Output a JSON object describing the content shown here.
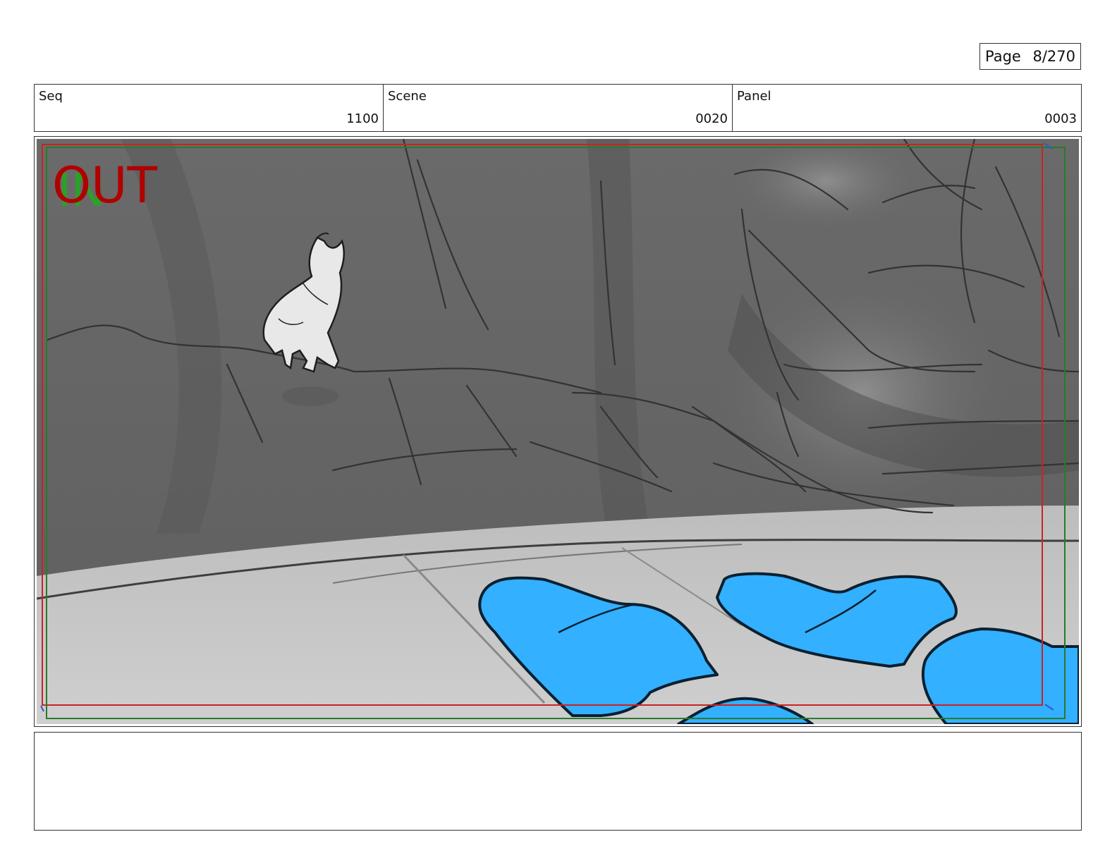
{
  "page": {
    "label": "Page",
    "number": "8/270"
  },
  "meta": {
    "seq": {
      "label": "Seq",
      "value": "1100"
    },
    "scene": {
      "label": "Scene",
      "value": "0020"
    },
    "panel": {
      "label": "Panel",
      "value": "0003"
    }
  },
  "panel_image": {
    "overlay_text": "OUT",
    "overlay_text_color": "#b00000",
    "shadow_text_color": "#22aa22",
    "safe_frame_color": "#cc2222",
    "action_frame_color": "#2a7a2a",
    "sky_color": "#676767",
    "ground_color": "#c9c9c9",
    "hand_color": "#33b0ff",
    "icons": [
      "horse-sketch-icon",
      "hand-silhouette-icon"
    ]
  },
  "notes": {
    "text": ""
  }
}
